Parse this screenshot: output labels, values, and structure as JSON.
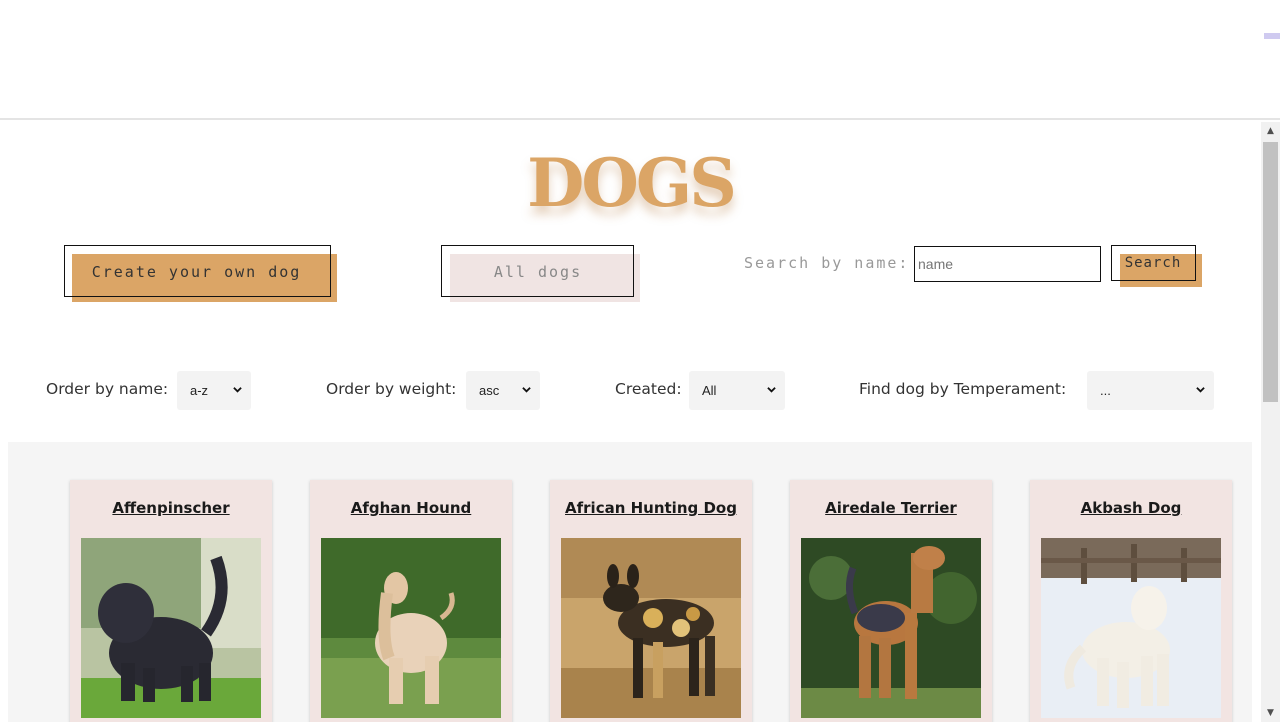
{
  "title": "DOGS",
  "buttons": {
    "create": "Create your own dog",
    "all": "All dogs",
    "search": "Search"
  },
  "search": {
    "label": "Search by name:",
    "placeholder": "name"
  },
  "filters": {
    "order_name": {
      "label": "Order by name:",
      "value": "a-z"
    },
    "order_weight": {
      "label": "Order by weight:",
      "value": "asc"
    },
    "created": {
      "label": "Created:",
      "value": "All"
    },
    "temperament": {
      "label": "Find dog by Temperament:",
      "value": "..."
    }
  },
  "cards": [
    {
      "name": "Affenpinscher",
      "image": "black-shaggy-dog-on-grass"
    },
    {
      "name": "Afghan Hound",
      "image": "cream-longhaired-hound-in-forest"
    },
    {
      "name": "African Hunting Dog",
      "image": "spotted-wild-dog-in-dry-grass"
    },
    {
      "name": "Airedale Terrier",
      "image": "tan-and-black-terrier-in-front-of-hedge"
    },
    {
      "name": "Akbash Dog",
      "image": "white-dog-in-snow"
    }
  ],
  "colors": {
    "accent": "#dba566",
    "pink": "#f2e4e2",
    "title": "#dba566"
  }
}
